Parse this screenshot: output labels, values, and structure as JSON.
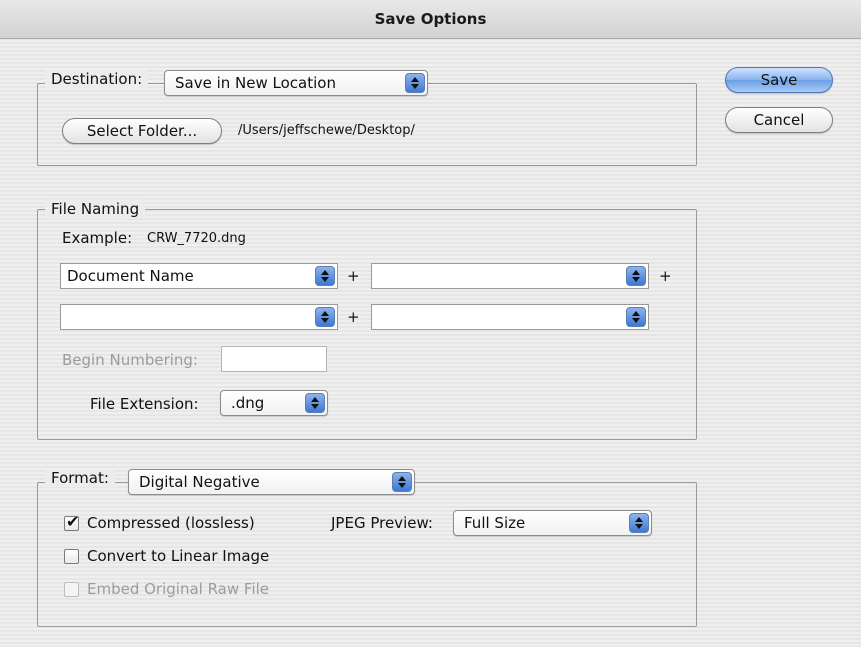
{
  "window": {
    "title": "Save Options"
  },
  "buttons": {
    "save": "Save",
    "cancel": "Cancel"
  },
  "destination": {
    "label": "Destination:",
    "value": "Save in New Location",
    "select_folder": "Select Folder...",
    "path": "/Users/jeffschewe/Desktop/"
  },
  "file_naming": {
    "title": "File Naming",
    "example_label": "Example:",
    "example_value": "CRW_7720.dng",
    "field1": "Document Name",
    "field2": "",
    "field3": "",
    "field4": "",
    "plus": "+",
    "begin_numbering_label": "Begin Numbering:",
    "begin_numbering_value": "",
    "extension_label": "File Extension:",
    "extension_value": ".dng"
  },
  "format": {
    "label": "Format:",
    "value": "Digital Negative",
    "compressed": {
      "label": "Compressed (lossless)",
      "checked": true
    },
    "linear": {
      "label": "Convert to Linear Image",
      "checked": false
    },
    "embed": {
      "label": "Embed Original Raw File",
      "checked": false,
      "disabled": true
    },
    "jpeg_label": "JPEG Preview:",
    "jpeg_value": "Full Size"
  },
  "icons": {
    "popup": "popup-arrows-icon",
    "check": "checkmark-icon"
  },
  "colors": {
    "accent": "#6b9fe6"
  }
}
